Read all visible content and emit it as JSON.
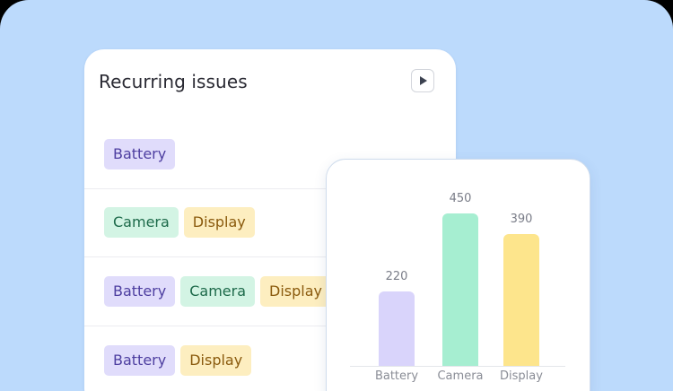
{
  "issues_panel": {
    "title": "Recurring issues",
    "play_icon": "play-icon",
    "rows": [
      {
        "tags": [
          {
            "label": "Battery",
            "kind": "battery"
          }
        ]
      },
      {
        "tags": [
          {
            "label": "Camera",
            "kind": "camera"
          },
          {
            "label": "Display",
            "kind": "display"
          }
        ]
      },
      {
        "tags": [
          {
            "label": "Battery",
            "kind": "battery"
          },
          {
            "label": "Camera",
            "kind": "camera"
          },
          {
            "label": "Display",
            "kind": "display"
          }
        ]
      },
      {
        "tags": [
          {
            "label": "Battery",
            "kind": "battery"
          },
          {
            "label": "Display",
            "kind": "display"
          }
        ]
      }
    ]
  },
  "colors": {
    "background": "#bcdafc",
    "battery": "#d9d4fb",
    "camera": "#a6eed1",
    "display": "#fde58c"
  },
  "chart_data": {
    "type": "bar",
    "categories": [
      "Battery",
      "Camera",
      "Display"
    ],
    "values": [
      220,
      450,
      390
    ],
    "ylim": [
      0,
      500
    ],
    "grid": false,
    "legend": "none"
  }
}
